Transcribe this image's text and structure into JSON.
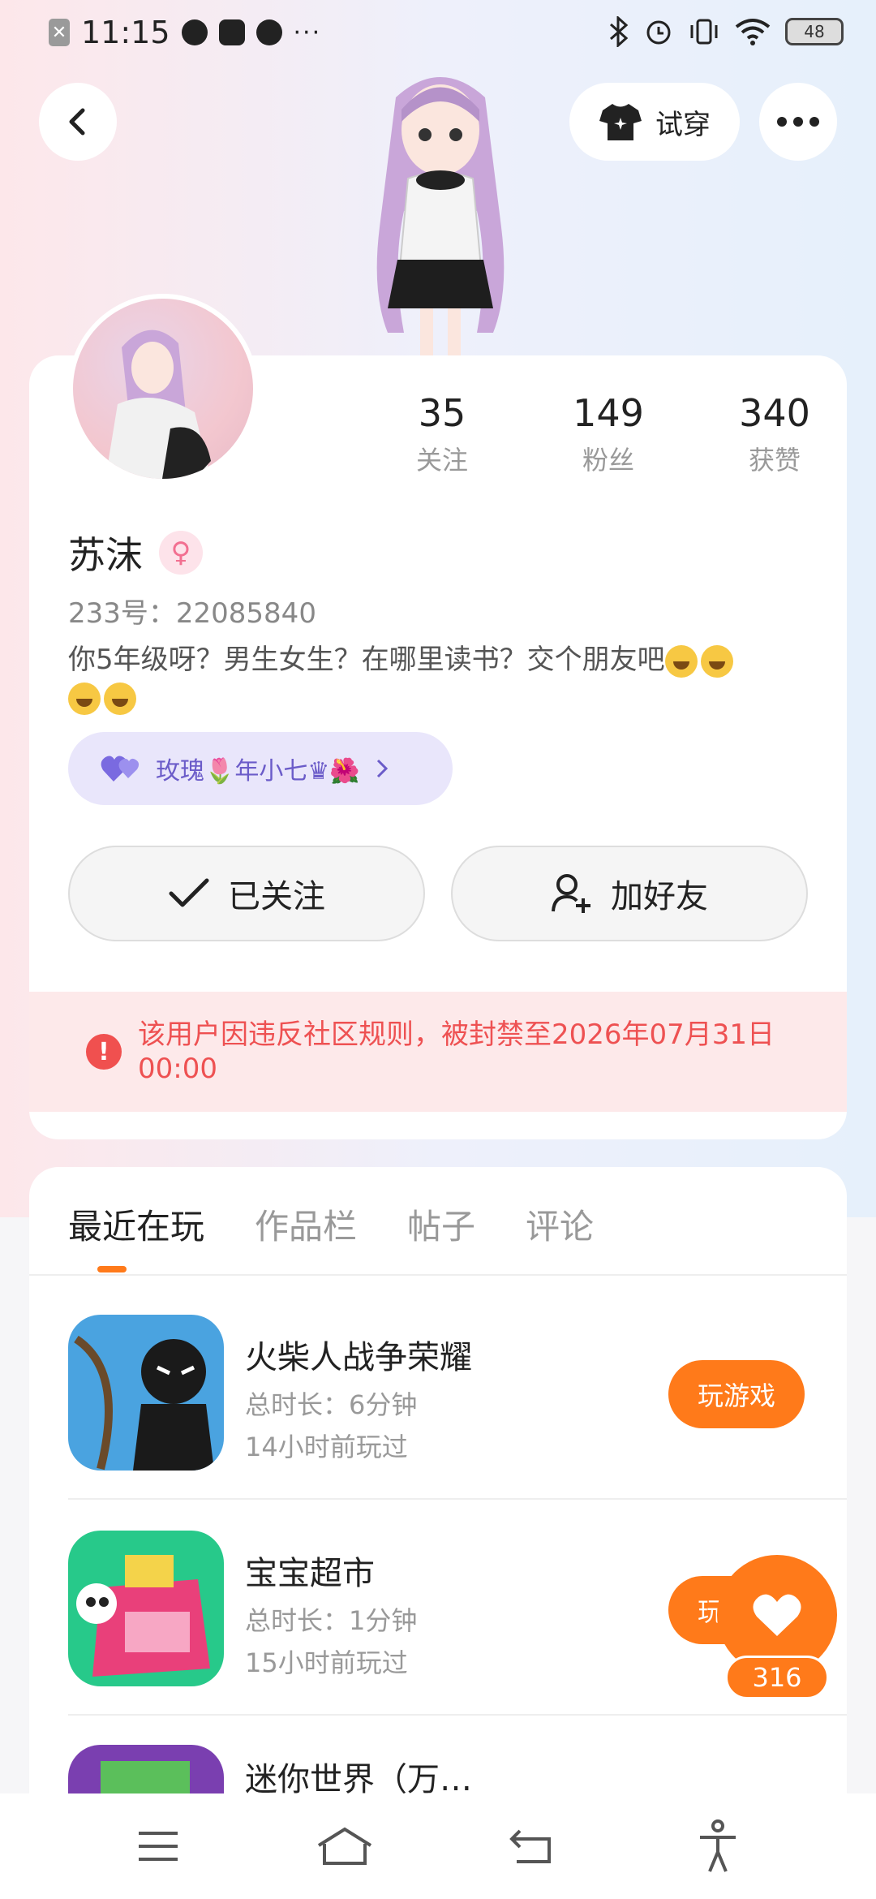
{
  "status_bar": {
    "time": "11:15",
    "dots": "···",
    "battery": "48"
  },
  "header": {
    "tryon_label": "试穿"
  },
  "profile": {
    "stats": [
      {
        "num": "35",
        "label": "关注"
      },
      {
        "num": "149",
        "label": "粉丝"
      },
      {
        "num": "340",
        "label": "获赞"
      }
    ],
    "name": "苏沫",
    "gender_symbol": "♀",
    "uid": "233号：22085840",
    "bio": "你5年级呀？男生女生？在哪里读书？交个朋友吧",
    "couple_tag": "玫瑰🌷年小七♛🌺",
    "follow_button": "已关注",
    "add_friend_button": "加好友",
    "ban_notice": "该用户因违反社区规则，被封禁至2026年07月31日 00:00"
  },
  "tabs": [
    "最近在玩",
    "作品栏",
    "帖子",
    "评论"
  ],
  "games": [
    {
      "title": "火柴人战争荣耀",
      "duration": "总时长：6分钟",
      "ago": "14小时前玩过",
      "button": "玩游戏"
    },
    {
      "title": "宝宝超市",
      "duration": "总时长：1分钟",
      "ago": "15小时前玩过",
      "button": "玩游戏"
    },
    {
      "title": "迷你世界（万…",
      "duration": "",
      "ago": "",
      "button": ""
    }
  ],
  "like_count": "316",
  "colors": {
    "accent": "#ff7a1a",
    "ban_text": "#ee5152",
    "couple_text": "#6b5cc9"
  }
}
